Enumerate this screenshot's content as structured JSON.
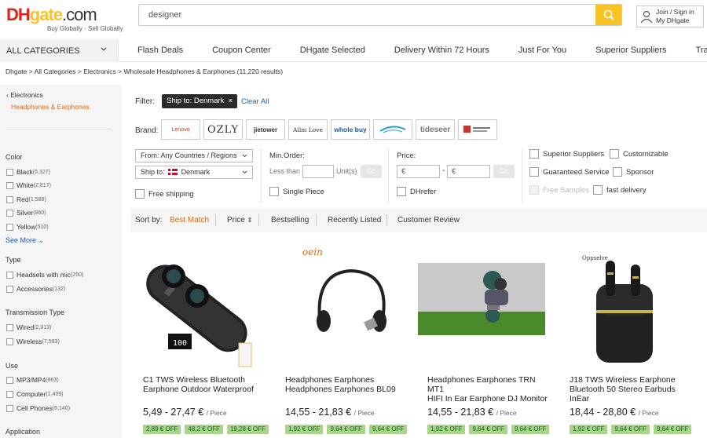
{
  "header": {
    "logo_tagline": "Buy Globally · Sell Globally",
    "search_value": "designer",
    "account_line1": "Join / Sign in",
    "account_line2": "My DHgate"
  },
  "nav": {
    "all_categories": "ALL CATEGORIES",
    "links": [
      "Flash Deals",
      "Coupon Center",
      "DHgate Selected",
      "Delivery Within 72 Hours",
      "Just For You",
      "Superior Suppliers",
      "Trade Show"
    ]
  },
  "breadcrumb": "Dhgate > All Categories > Electronics > Wholesale Headphones & Earphones (11,220 results)",
  "sidebar": {
    "parent_category": "Electronics",
    "current_category": "Headphones & Earphones",
    "color_title": "Color",
    "colors": [
      {
        "label": "Black",
        "count": "(6,327)"
      },
      {
        "label": "White",
        "count": "(2,817)"
      },
      {
        "label": "Red",
        "count": "(1,588)"
      },
      {
        "label": "Silver",
        "count": "(860)"
      },
      {
        "label": "Yellow",
        "count": "(510)"
      }
    ],
    "see_more": "See More",
    "type_title": "Type",
    "types": [
      {
        "label": "Headsets with mic",
        "count": "(250)"
      },
      {
        "label": "Accessories",
        "count": "(132)"
      }
    ],
    "transmission_title": "Transmission Type",
    "transmissions": [
      {
        "label": "Wired",
        "count": "(2,013)"
      },
      {
        "label": "Wireless",
        "count": "(7,593)"
      }
    ],
    "use_title": "Use",
    "uses": [
      {
        "label": "MP3/MP4",
        "count": "(863)"
      },
      {
        "label": "Computer",
        "count": "(1,409)"
      },
      {
        "label": "Cell Phones",
        "count": "(6,140)"
      }
    ],
    "application_title": "Application"
  },
  "filters": {
    "filter_label": "Filter:",
    "chip": "Ship to: Denmark",
    "clear_all": "Clear All",
    "brand_label": "Brand:",
    "brands": [
      "Lenovo",
      "OZLY",
      "jietower",
      "Allm Love",
      "whole buy",
      "",
      "tideseer",
      ""
    ],
    "from_label": "From: Any Countries / Regions",
    "shipto_label": "Ship to:",
    "shipto_value": "Denmark",
    "free_shipping": "Free shipping",
    "min_order_label": "Min.Order:",
    "less_than": "Less than",
    "units": "Unit(s)",
    "go": "Go",
    "single_piece": "Single Piece",
    "price_label": "Price:",
    "euro": "€",
    "dash": "-",
    "dhrefer": "DHrefer",
    "superior_suppliers": "Superior Suppliers",
    "customizable": "Customizable",
    "guaranteed_service": "Guaranteed Service",
    "sponsor": "Sponsor",
    "free_samples": "Free Samples",
    "fast_delivery": "fast delivery"
  },
  "sort": {
    "label": "Sort by:",
    "options": [
      "Best Match",
      "Price",
      "Bestselling",
      "Recently Listed",
      "Customer Review"
    ],
    "active": "Best Match"
  },
  "products": [
    {
      "title_line1": "C1 TWS Wireless Bluetooth",
      "title_line2": "Earphone Outdoor Waterproof",
      "price": "5,49 - 27,47 €",
      "unit": "/ Piece",
      "coupons": [
        "2,89 € OFF",
        "48,2 € OFF",
        "19,28 € OFF"
      ],
      "image_text": "100"
    },
    {
      "title_line1": "Headphones Earphones",
      "title_line2": "Headphones Earphones BL09",
      "price": "14,55 - 21,83 €",
      "unit": "/ Piece",
      "coupons": [
        "1,92 € OFF",
        "9,64 € OFF",
        "9,64 € OFF"
      ],
      "image_text": "oein"
    },
    {
      "title_line1": "Headphones Earphones TRN MT1",
      "title_line2": "HIFI In Ear Earphone DJ Monitor",
      "price": "14,55 - 21,83 €",
      "unit": "/ Piece",
      "coupons": [
        "1,92 € OFF",
        "9,64 € OFF",
        "9,64 € OFF"
      ],
      "image_text": ""
    },
    {
      "title_line1": "J18 TWS Wireless Earphone",
      "title_line2": "Bluetooth 50 Stereo Earbuds InEar",
      "price": "18,44 - 28,80 €",
      "unit": "/ Piece",
      "coupons": [
        "1,92 € OFF",
        "9,64 € OFF",
        "9,64 € OFF"
      ],
      "image_text": "Oppselve"
    }
  ],
  "colors": {
    "accent_orange": "#e8650a",
    "search_yellow": "#f7c325",
    "link_blue": "#1a5dad",
    "coupon_green": "#a8d58a"
  }
}
